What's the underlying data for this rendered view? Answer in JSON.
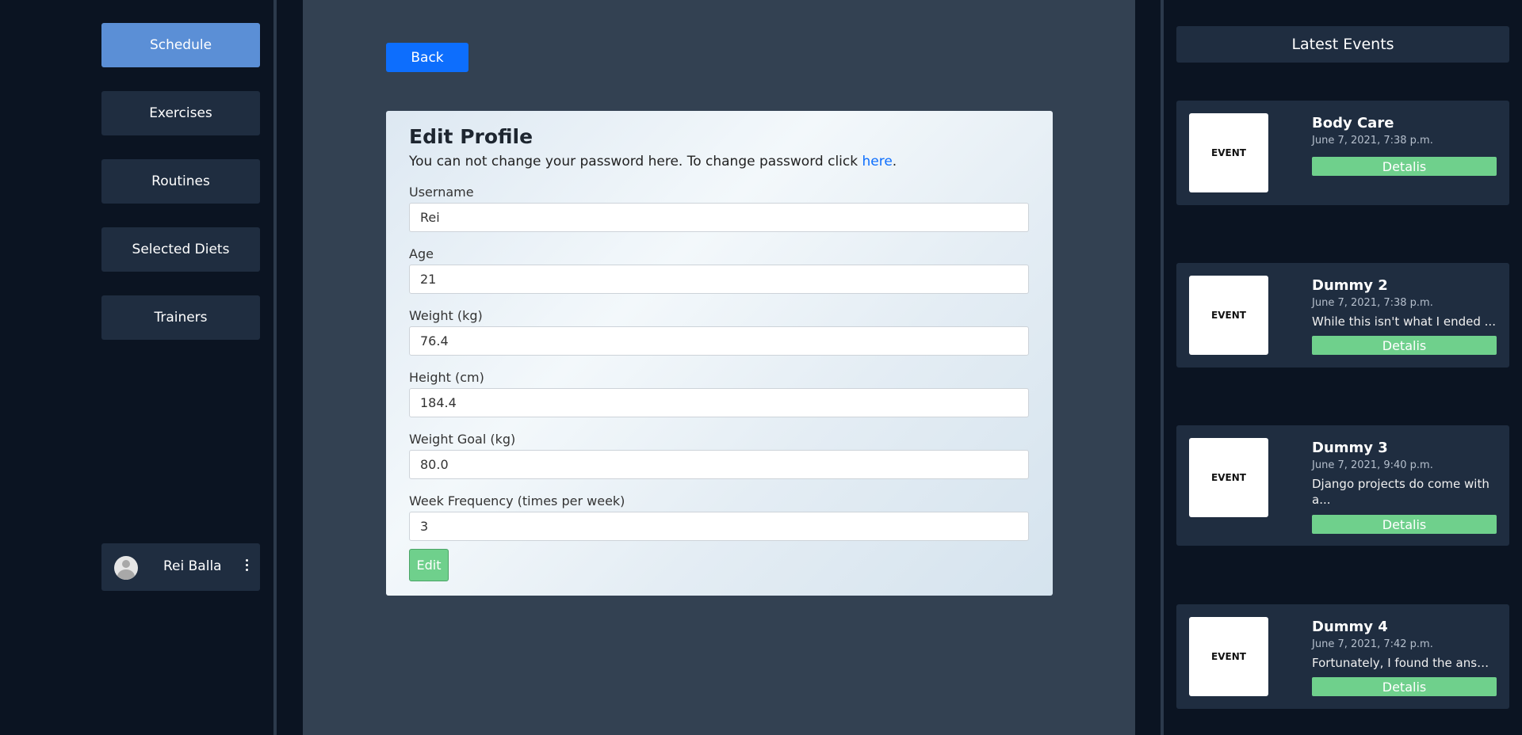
{
  "sidebar": {
    "items": [
      {
        "label": "Schedule",
        "active": true
      },
      {
        "label": "Exercises"
      },
      {
        "label": "Routines"
      },
      {
        "label": "Selected Diets"
      },
      {
        "label": "Trainers"
      }
    ],
    "user": {
      "name": "Rei Balla"
    }
  },
  "main": {
    "back_label": "Back",
    "form": {
      "title": "Edit Profile",
      "note_text": "You can not change your password here. To change password click ",
      "note_link": "here",
      "note_end": ".",
      "fields": [
        {
          "label": "Username",
          "value": "Rei"
        },
        {
          "label": "Age",
          "value": "21"
        },
        {
          "label": "Weight (kg)",
          "value": "76.4"
        },
        {
          "label": "Height (cm)",
          "value": "184.4"
        },
        {
          "label": "Weight Goal (kg)",
          "value": "80.0"
        },
        {
          "label": "Week Frequency (times per week)",
          "value": "3"
        }
      ],
      "submit_label": "Edit"
    }
  },
  "events": {
    "header": "Latest Events",
    "items": [
      {
        "thumb": "EVENT",
        "title": "Body Care",
        "date": "June 7, 2021, 7:38 p.m.",
        "desc": "",
        "button": "Detalis"
      },
      {
        "thumb": "EVENT",
        "title": "Dummy 2",
        "date": "June 7, 2021, 7:38 p.m.",
        "desc": "While this isn't what I ended ...",
        "button": "Detalis"
      },
      {
        "thumb": "EVENT",
        "title": "Dummy 3",
        "date": "June 7, 2021, 9:40 p.m.",
        "desc": "Django projects do come with a...",
        "button": "Detalis"
      },
      {
        "thumb": "EVENT",
        "title": "Dummy 4",
        "date": "June 7, 2021, 7:42 p.m.",
        "desc": "Fortunately, I found the answe...",
        "button": "Detalis"
      }
    ]
  },
  "colors": {
    "page_bg": "#0b1422",
    "panel": "#1f2d40",
    "main_bg": "#334152",
    "active_nav": "#5b8fd6",
    "primary": "#0d6efd",
    "success": "#6fd08c"
  }
}
